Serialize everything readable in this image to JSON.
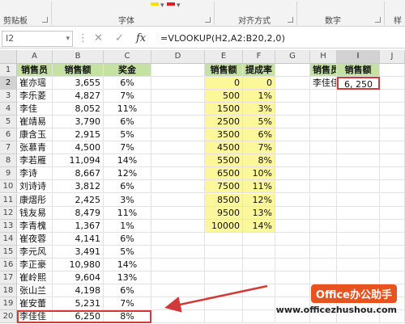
{
  "ribbon": {
    "groups": [
      {
        "name": "clipboard",
        "label": "剪贴板"
      },
      {
        "name": "font",
        "label": "字体"
      },
      {
        "name": "alignment",
        "label": "对齐方式"
      },
      {
        "name": "number",
        "label": "数字"
      },
      {
        "name": "styles",
        "label": "样"
      }
    ],
    "highlight_color": "#ffe000",
    "font_color": "#e02020"
  },
  "formula_bar": {
    "name_box": "I2",
    "cancel_icon": "✕",
    "enter_icon": "✓",
    "fx_icon": "fx",
    "formula": "=VLOOKUP(H2,A2:B20,2,0)"
  },
  "columns": [
    "A",
    "B",
    "C",
    "D",
    "E",
    "F",
    "G",
    "H",
    "I",
    "J"
  ],
  "selected_column": "I",
  "selected_row": 2,
  "sales_table": {
    "headers": [
      "销售员",
      "销售额",
      "奖金"
    ],
    "rows": [
      [
        "崔亦瑶",
        "3,655",
        "6%"
      ],
      [
        "李乐菱",
        "4,827",
        "7%"
      ],
      [
        "李佳",
        "8,052",
        "11%"
      ],
      [
        "崔靖易",
        "3,790",
        "6%"
      ],
      [
        "康含玉",
        "2,915",
        "5%"
      ],
      [
        "张慕青",
        "4,500",
        "7%"
      ],
      [
        "李若雁",
        "11,094",
        "14%"
      ],
      [
        "李诗",
        "8,667",
        "12%"
      ],
      [
        "刘诗诗",
        "3,812",
        "6%"
      ],
      [
        "康熠彤",
        "2,425",
        "3%"
      ],
      [
        "钱友易",
        "8,479",
        "11%"
      ],
      [
        "李青槐",
        "1,367",
        "1%"
      ],
      [
        "崔夜蓉",
        "4,141",
        "6%"
      ],
      [
        "李元风",
        "3,491",
        "5%"
      ],
      [
        "李正豪",
        "10,980",
        "14%"
      ],
      [
        "崔岭熙",
        "9,604",
        "13%"
      ],
      [
        "张山兰",
        "4,198",
        "6%"
      ],
      [
        "崔安蕾",
        "5,231",
        "7%"
      ],
      [
        "李佳佳",
        "6,250",
        "8%"
      ]
    ]
  },
  "rate_table": {
    "headers": [
      "销售额",
      "提成率"
    ],
    "rows": [
      [
        "0",
        "0"
      ],
      [
        "500",
        "1%"
      ],
      [
        "1500",
        "3%"
      ],
      [
        "2500",
        "5%"
      ],
      [
        "3500",
        "6%"
      ],
      [
        "4500",
        "7%"
      ],
      [
        "5500",
        "8%"
      ],
      [
        "6500",
        "10%"
      ],
      [
        "7500",
        "11%"
      ],
      [
        "8500",
        "12%"
      ],
      [
        "9500",
        "13%"
      ],
      [
        "10000",
        "14%"
      ]
    ]
  },
  "lookup": {
    "headers": [
      "销售员",
      "销售额"
    ],
    "name": "李佳佳",
    "result": "6, 250"
  },
  "watermark": {
    "badge": "Office办公助手",
    "url": "www.officezhushou.com"
  },
  "accent_colors": {
    "header_green": "#c6e2a2",
    "rate_yellow": "#fbf79a",
    "highlight_red": "#d23a3a",
    "watermark_orange": "#e8521f"
  }
}
